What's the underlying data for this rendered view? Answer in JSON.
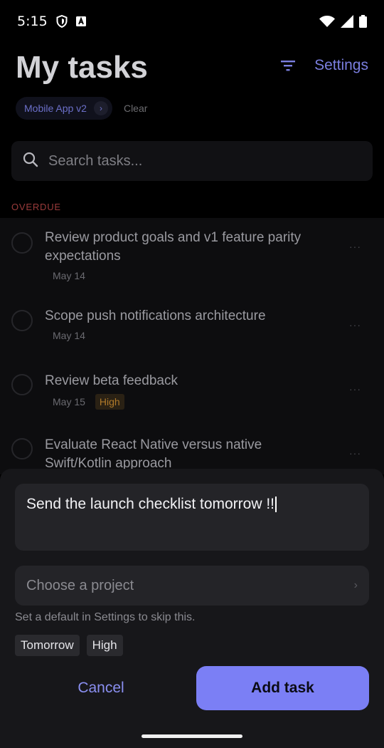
{
  "status_bar": {
    "time": "5:15"
  },
  "header": {
    "title": "My tasks",
    "settings_label": "Settings"
  },
  "filter": {
    "project_chip": "Mobile App v2",
    "chip_chevron": "›",
    "clear_label": "Clear"
  },
  "search": {
    "placeholder": "Search tasks..."
  },
  "section": {
    "label": "OVERDUE"
  },
  "tasks": [
    {
      "title": "Review product goals and v1 feature parity expectations",
      "date": "May 14",
      "priority": ""
    },
    {
      "title": "Scope push notifications architecture",
      "date": "May 14",
      "priority": ""
    },
    {
      "title": "Review beta feedback",
      "date": "May 15",
      "priority": "High"
    },
    {
      "title": "Evaluate React Native versus native Swift/Kotlin approach",
      "date": "",
      "priority": ""
    }
  ],
  "more_glyph": "···",
  "composer": {
    "text": "Send the launch checklist tomorrow !!",
    "project_placeholder": "Choose a project",
    "select_chevron": "›",
    "hint": "Set a default in Settings to skip this.",
    "tags": [
      "Tomorrow",
      "High"
    ],
    "cancel_label": "Cancel",
    "add_label": "Add task"
  },
  "colors": {
    "accent": "#7b7ff5",
    "overdue": "#9a3b3b",
    "priority_high": "#b07a2a"
  }
}
